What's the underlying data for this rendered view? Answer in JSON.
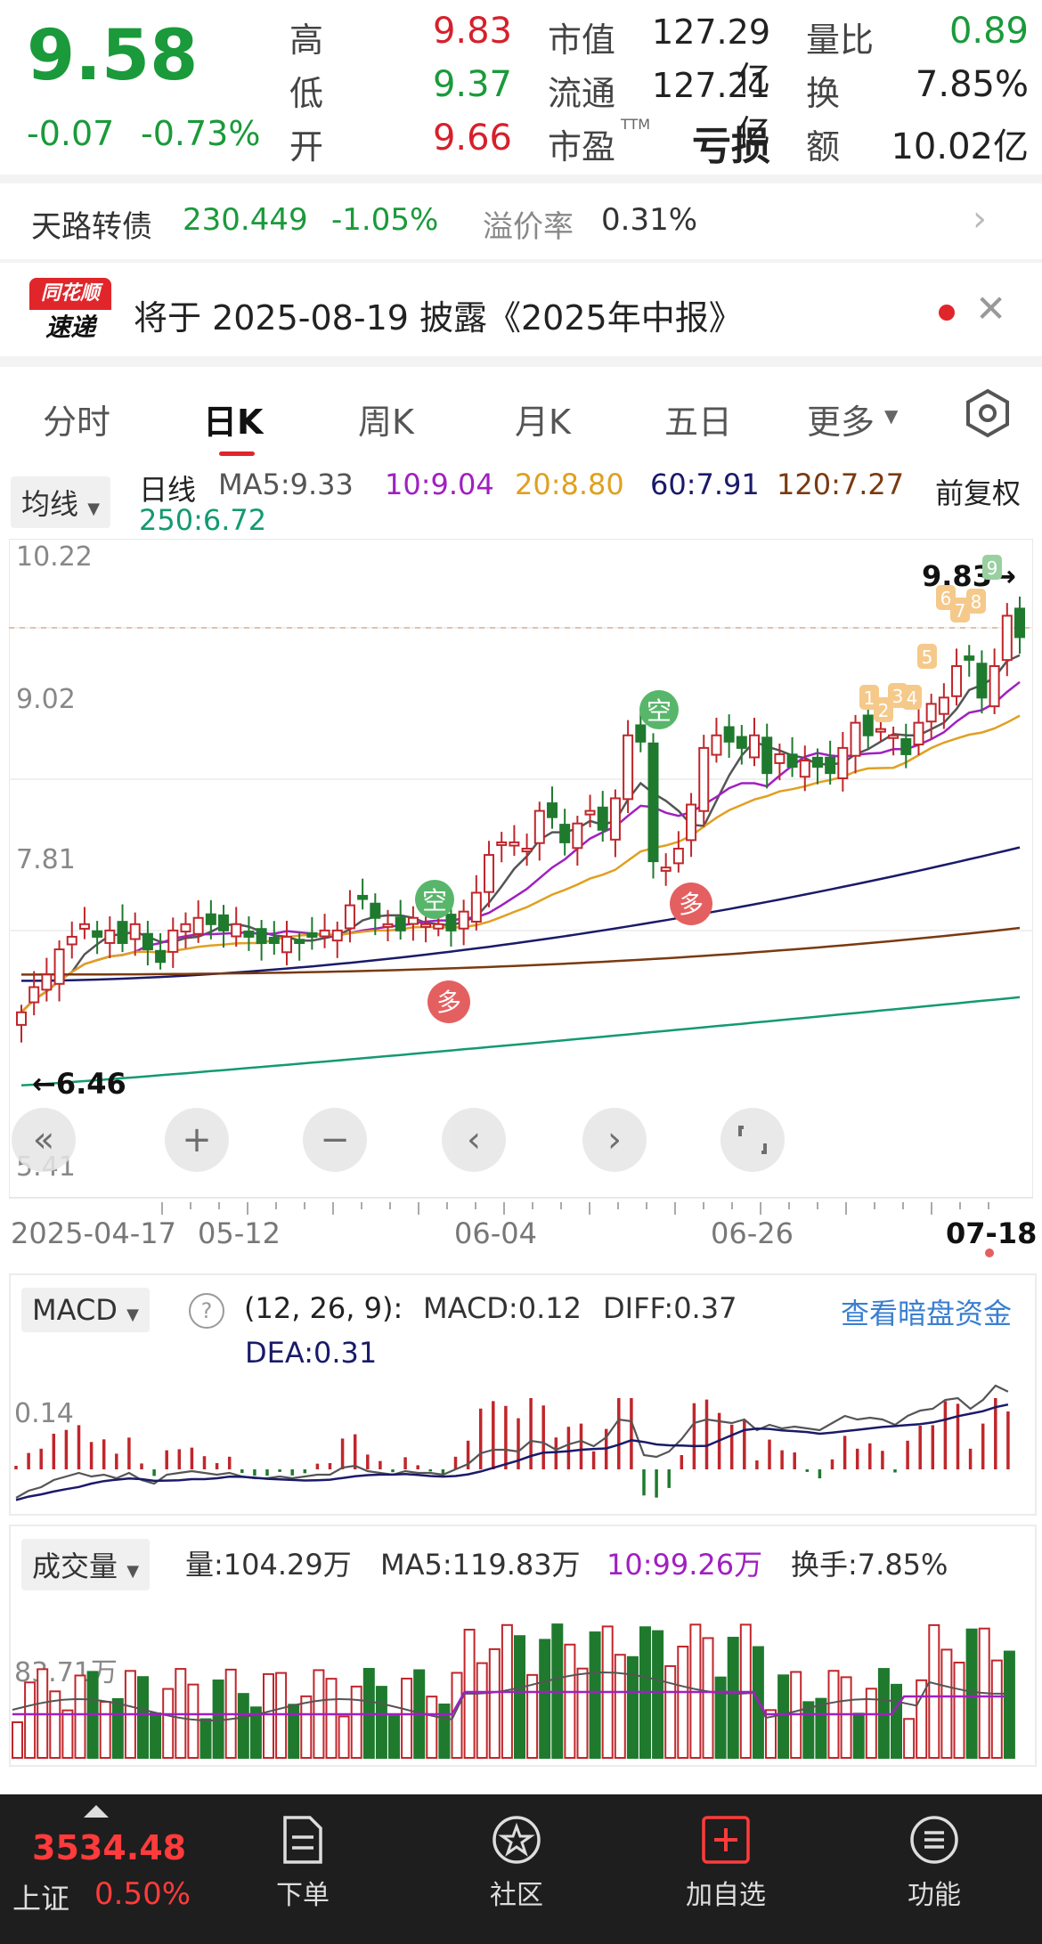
{
  "quote": {
    "price": "9.58",
    "change": "-0.07",
    "change_pct": "-0.73%",
    "high_label": "高",
    "high": "9.83",
    "low_label": "低",
    "low": "9.37",
    "open_label": "开",
    "open": "9.66",
    "mcap_label": "市值",
    "mcap": "127.29亿",
    "float_label": "流通",
    "float": "127.21亿",
    "pe_label": "市盈",
    "pe_sup": "TTM",
    "pe": "亏损",
    "vr_label": "量比",
    "vr": "0.89",
    "turn_label": "换",
    "turn": "7.85%",
    "amt_label": "额",
    "amt": "10.02亿"
  },
  "convertible": {
    "name": "天路转债",
    "price": "230.449",
    "change_pct": "-1.05%",
    "premium_label": "溢价率",
    "premium": "0.31%"
  },
  "notice": {
    "logo_top": "同花顺",
    "logo_bottom": "速递",
    "text": "将于 2025-08-19 披露《2025年中报》"
  },
  "tabs": [
    "分时",
    "日K",
    "周K",
    "月K",
    "五日",
    "更多"
  ],
  "active_tab": "日K",
  "ma": {
    "selector": "均线",
    "period": "日线",
    "ma5": "MA5:9.33",
    "ma10": "10:9.04",
    "ma20": "20:8.80",
    "ma60": "60:7.91",
    "ma120": "120:7.27",
    "ma250": "250:6.72",
    "adjust": "前复权"
  },
  "chart_data": {
    "type": "candlestick",
    "y_ticks": [
      "10.22",
      "9.02",
      "7.81",
      "5.41"
    ],
    "high_marker": "9.83→",
    "low_marker": "←6.46",
    "x_ticks": [
      "2025-04-17",
      "05-12",
      "06-04",
      "06-26",
      "07-18"
    ],
    "signals": [
      "空",
      "多",
      "空",
      "多"
    ],
    "badges": [
      "1",
      "2",
      "3",
      "4",
      "5",
      "6",
      "7",
      "8",
      "9"
    ],
    "closes": [
      6.6,
      6.8,
      6.9,
      7.1,
      7.2,
      7.3,
      7.2,
      7.25,
      7.15,
      7.3,
      7.1,
      7.0,
      7.25,
      7.3,
      7.35,
      7.3,
      7.25,
      7.3,
      7.2,
      7.15,
      7.15,
      7.2,
      7.15,
      7.2,
      7.25,
      7.25,
      7.45,
      7.5,
      7.35,
      7.3,
      7.25,
      7.35,
      7.3,
      7.3,
      7.25,
      7.4,
      7.55,
      7.85,
      7.95,
      7.95,
      7.9,
      8.2,
      8.15,
      7.95,
      8.1,
      8.2,
      8.05,
      8.3,
      8.8,
      8.75,
      7.8,
      7.75,
      7.9,
      8.25,
      8.7,
      8.8,
      8.75,
      8.7,
      8.8,
      8.5,
      8.65,
      8.55,
      8.6,
      8.55,
      8.5,
      8.7,
      8.9,
      8.8,
      8.85,
      8.8,
      8.65,
      8.9,
      9.05,
      9.1,
      9.35,
      9.4,
      9.1,
      9.35,
      9.75,
      9.58
    ],
    "ma_colors": {
      "ma5": "#555555",
      "ma10": "#a020c0",
      "ma20": "#e0a020",
      "ma60": "#1a1a6a",
      "ma120": "#7a3a10",
      "ma250": "#139a72"
    }
  },
  "nav": {
    "b1": "«",
    "b2": "+",
    "b3": "−",
    "b4": "‹",
    "b5": "›"
  },
  "macd": {
    "selector": "MACD",
    "help": "?",
    "params": "(12, 26, 9):",
    "macd": "MACD:0.12",
    "diff": "DIFF:0.37",
    "dea": "DEA:0.31",
    "link": "查看暗盘资金",
    "tick": "0.14"
  },
  "volume": {
    "selector": "成交量",
    "vol": "量:104.29万",
    "ma5": "MA5:119.83万",
    "ma10": "10:99.26万",
    "turnover": "换手:7.85%",
    "tick": "83.71万"
  },
  "bottom": {
    "index_value": "3534.48",
    "index_name": "上证",
    "index_pct": "0.50%",
    "order": "下单",
    "community": "社区",
    "add": "加自选",
    "func": "功能"
  }
}
